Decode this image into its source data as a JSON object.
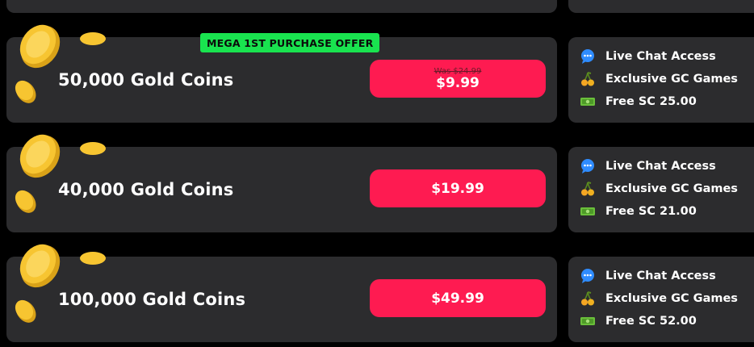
{
  "offer_badge": "MEGA 1ST PURCHASE OFFER",
  "packages": [
    {
      "title": "50,000 Gold Coins",
      "was_price": "Was $24.99",
      "price": "$9.99",
      "perks": [
        "Live Chat Access",
        "Exclusive GC Games",
        "Free SC 25.00"
      ]
    },
    {
      "title": "40,000 Gold Coins",
      "price": "$19.99",
      "perks": [
        "Live Chat Access",
        "Exclusive GC Games",
        "Free SC 21.00"
      ]
    },
    {
      "title": "100,000 Gold Coins",
      "price": "$49.99",
      "perks": [
        "Live Chat Access",
        "Exclusive GC Games",
        "Free SC 52.00"
      ]
    }
  ],
  "perk_icons": [
    "chat-bubble-icon",
    "cherries-icon",
    "cash-icon"
  ],
  "colors": {
    "background": "#000000",
    "card": "#2c2c2e",
    "button": "#fe1b51",
    "badge": "#19e34f",
    "chat_icon": "#2f8cff",
    "coin": "#f7c531"
  }
}
